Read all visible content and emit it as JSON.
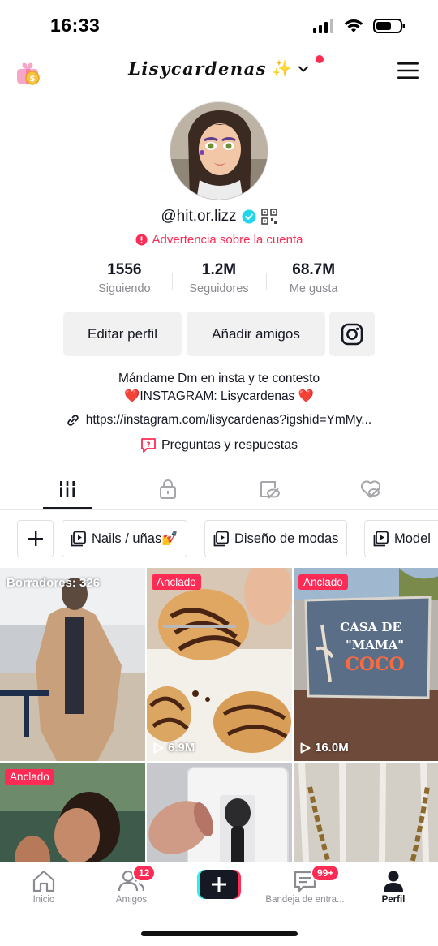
{
  "status_bar": {
    "time": "16:33"
  },
  "header": {
    "username": "Lisycardenas",
    "sparkle": "✨"
  },
  "profile": {
    "handle": "@hit.or.lizz",
    "warning": "Advertencia sobre la cuenta",
    "stats": [
      {
        "value": "1556",
        "label": "Siguiendo"
      },
      {
        "value": "1.2M",
        "label": "Seguidores"
      },
      {
        "value": "68.7M",
        "label": "Me gusta"
      }
    ],
    "buttons": {
      "edit": "Editar perfil",
      "add_friends": "Añadir amigos"
    },
    "bio_line1": "Mándame Dm en insta y te contesto",
    "bio_line2": "❤️INSTAGRAM: Lisycardenas ❤️",
    "link": "https://instagram.com/lisycardenas?igshid=YmMy...",
    "qa": "Preguntas y respuestas"
  },
  "playlists": {
    "chips": [
      {
        "label": "Nails / uñas💅"
      },
      {
        "label": "Diseño de modas"
      },
      {
        "label": "Model"
      }
    ]
  },
  "grid": {
    "drafts": "Borradores: 326",
    "items": [
      {
        "pin": "",
        "views": ""
      },
      {
        "pin": "Anclado",
        "views": "6.9M"
      },
      {
        "pin": "Anclado",
        "views": "16.0M"
      },
      {
        "pin": "Anclado",
        "views": ""
      },
      {
        "pin": "",
        "views": ""
      },
      {
        "pin": "",
        "views": ""
      }
    ]
  },
  "bottom_nav": {
    "items": [
      {
        "label": "Inicio"
      },
      {
        "label": "Amigos",
        "badge": "12"
      },
      {
        "label": ""
      },
      {
        "label": "Bandeja de entra...",
        "badge": "99+"
      },
      {
        "label": "Perfil"
      }
    ]
  },
  "colors": {
    "accent": "#fe2c55",
    "verified": "#20d5ec",
    "text": "#161823",
    "muted": "#8a8b91"
  }
}
